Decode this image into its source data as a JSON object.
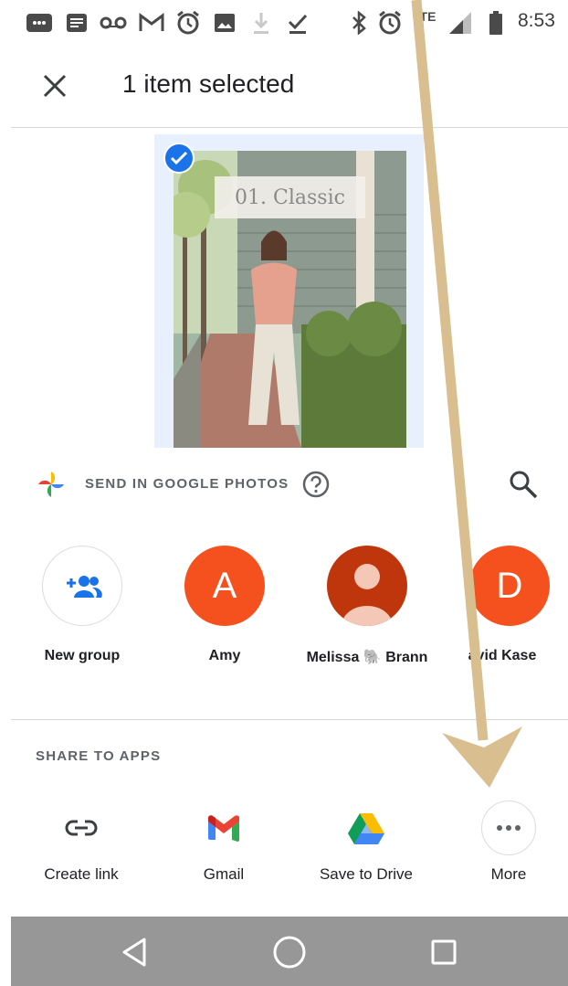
{
  "status_bar": {
    "time": "8:53",
    "network": "LTE",
    "icons": [
      "message-icon",
      "notes-icon",
      "voicemail-icon",
      "gmail-icon",
      "alarm-icon",
      "image-icon",
      "download-icon",
      "done-icon",
      "bluetooth-icon",
      "alarm-icon",
      "signal-icon",
      "battery-icon"
    ]
  },
  "header": {
    "title": "1 item selected",
    "close_icon": "close-icon"
  },
  "photo": {
    "overlay_text": "01. Classic",
    "selected": true
  },
  "google_photos": {
    "label": "SEND IN GOOGLE PHOTOS",
    "help_icon": "help-icon",
    "search_icon": "search-icon"
  },
  "contacts": [
    {
      "name": "New group",
      "type": "group"
    },
    {
      "name": "Amy",
      "initial": "A",
      "color": "#f4511e"
    },
    {
      "name": "Melissa 🐘 Brann",
      "type": "person-placeholder",
      "color": "#bf360c"
    },
    {
      "name": "avid Kase",
      "initial": "D",
      "color": "#f4511e"
    }
  ],
  "share_apps": {
    "label": "SHARE TO APPS",
    "apps": [
      {
        "label": "Create link",
        "icon": "link-icon"
      },
      {
        "label": "Gmail",
        "icon": "gmail-logo-icon"
      },
      {
        "label": "Save to Drive",
        "icon": "google-drive-icon"
      },
      {
        "label": "More",
        "icon": "more-horiz-icon"
      }
    ]
  },
  "nav_bar": {
    "buttons": [
      "back-icon",
      "home-icon",
      "recents-icon"
    ],
    "color": "#979797"
  },
  "annotation": {
    "arrow_color": "#d9bf8f"
  }
}
